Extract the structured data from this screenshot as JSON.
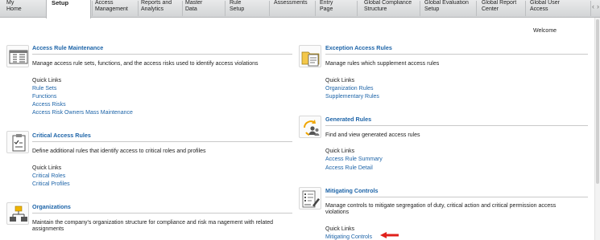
{
  "nav": {
    "tabs": [
      {
        "line1": "My",
        "line2": "Home"
      },
      {
        "line1": "Setup",
        "line2": ""
      },
      {
        "line1": "Access",
        "line2": "Management"
      },
      {
        "line1": "Reports and",
        "line2": "Analytics"
      },
      {
        "line1": "Master",
        "line2": "Data"
      },
      {
        "line1": "Rule",
        "line2": "Setup"
      },
      {
        "line1": "Assessments",
        "line2": ""
      },
      {
        "line1": "Entry",
        "line2": "Page"
      },
      {
        "line1": "Global Compliance",
        "line2": "Structure"
      },
      {
        "line1": "Global Evaluation",
        "line2": "Setup"
      },
      {
        "line1": "Global Report",
        "line2": "Center"
      },
      {
        "line1": "Global User",
        "line2": "Access"
      }
    ],
    "active_index": 1
  },
  "welcome": "Welcome",
  "sections": {
    "access_rule_maintenance": {
      "title": "Access Rule Maintenance",
      "description": "Manage access rule sets, functions, and the access risks used to identify access violations",
      "quick_links_label": "Quick Links",
      "links": [
        "Rule Sets",
        "Functions",
        "Access Risks",
        "Access Risk Owners Mass Maintenance"
      ]
    },
    "critical_access_rules": {
      "title": "Critical Access Rules",
      "description": "Define additional rules that identify access to critical roles and profiles",
      "quick_links_label": "Quick Links",
      "links": [
        "Critical Roles",
        "Critical Profiles"
      ]
    },
    "organizations": {
      "title": "Organizations",
      "description_line1": "Maintain the company's organization structure for compliance and risk ma nagement with related",
      "description_line2": "assignments"
    },
    "exception_access_rules": {
      "title": "Exception Access Rules",
      "description": "Manage rules which supplement access rules",
      "quick_links_label": "Quick Links",
      "links": [
        "Organization Rules",
        "Supplementary Rules"
      ]
    },
    "generated_rules": {
      "title": "Generated Rules",
      "description": "Find and view generated access rules",
      "quick_links_label": "Quick Links",
      "links": [
        "Access Rule Summary",
        "Access Rule Detail"
      ]
    },
    "mitigating_controls": {
      "title": "Mitigating Controls",
      "description_line1": "Manage controls to mitigate segregation of duty, critical action and critical permission access",
      "description_line2": "violations",
      "quick_links_label": "Quick Links",
      "links": [
        "Mitigating Controls"
      ]
    }
  },
  "colors": {
    "link": "#1d64a8",
    "annotation_arrow": "#e0201b"
  },
  "icons": [
    "table-list-icon",
    "folder-document-icon",
    "clipboard-check-icon",
    "refresh-users-icon",
    "org-chart-icon",
    "list-pen-icon",
    "red-arrow-icon"
  ]
}
